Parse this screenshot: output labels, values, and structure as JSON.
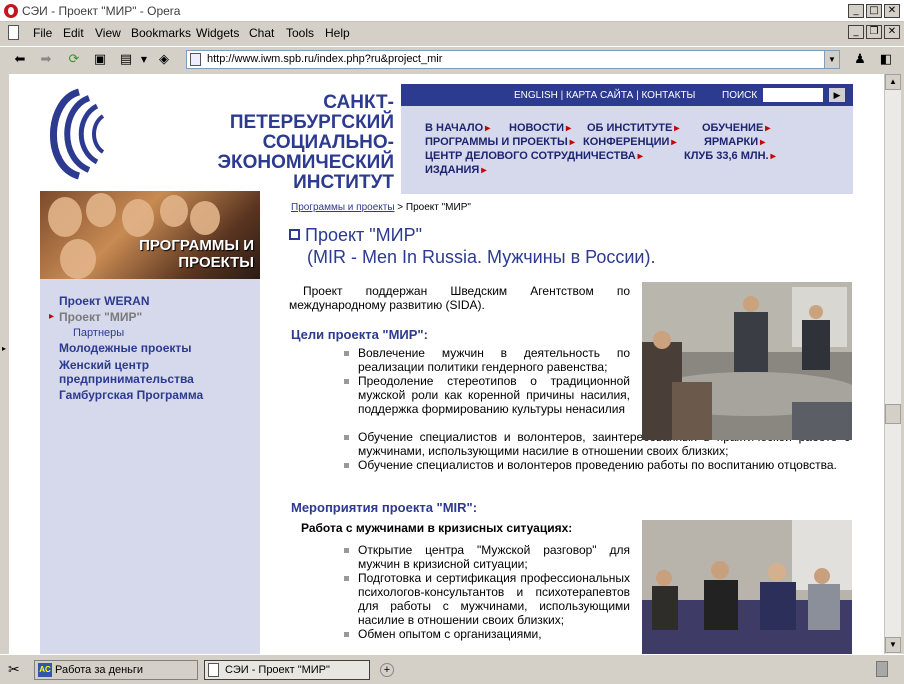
{
  "window": {
    "title": "СЭИ - Проект \"МИР\" - Opera"
  },
  "menu": [
    "File",
    "Edit",
    "View",
    "Bookmarks",
    "Widgets",
    "Chat",
    "Tools",
    "Help"
  ],
  "address": {
    "url": "http://www.iwm.spb.ru/index.php?ru&project_mir"
  },
  "site": {
    "logo_text": [
      "САНКТ-ПЕТЕРБУРГСКИЙ",
      "СОЦИАЛЬНО-",
      "ЭКОНОМИЧЕСКИЙ",
      "ИНСТИТУТ"
    ],
    "top_links": "ENGLISH | КАРТА САЙТА | КОНТАКТЫ",
    "search_label": "ПОИСК",
    "nav": [
      "В НАЧАЛО",
      "НОВОСТИ",
      "ОБ ИНСТИТУТЕ",
      "ОБУЧЕНИЕ",
      "ПРОГРАММЫ И ПРОЕКТЫ",
      "КОНФЕРЕНЦИИ",
      "ЯРМАРКИ",
      "ЦЕНТР ДЕЛОВОГО СОТРУДНИЧЕСТВА",
      "КЛУБ 33,6 МЛН.",
      "ИЗДАНИЯ"
    ]
  },
  "left": {
    "banner_text": "ПРОГРАММЫ И ПРОЕКТЫ",
    "items": [
      "Проект WERAN",
      "Проект \"МИР\"",
      "Партнеры",
      "Молодежные проекты",
      "Женский центр",
      "предпринимательства",
      "Гамбургская Программа"
    ]
  },
  "content": {
    "crumb_link": "Программы и проекты",
    "crumb_current": " > Проект \"МИР\"",
    "title_line1": "Проект \"МИР\"",
    "title_line2": "(MIR - Men In Russia. Мужчины в России).",
    "intro": "Проект поддержан Шведским Агентством по международному развитию (SIDA).",
    "goals_heading": "Цели проекта \"МИР\":",
    "goals": [
      "Вовлечение мужчин в деятельность по реализации политики гендерного равенства;",
      "Преодоление стереотипов о традиционной мужской роли как коренной причины насилия, поддержка формированию культуры ненасилия",
      "Обучение специалистов и волонтеров, заинтересованных в практической работе с мужчинами, использующими насилие в отношении своих близких;",
      "Обучение специалистов и волонтеров проведению работы по воспитанию отцовства."
    ],
    "events_heading": "Мероприятия проекта \"MIR\":",
    "crisis_heading": "Работа с мужчинами в кризисных ситуациях:",
    "events": [
      "Открытие центра \"Мужской разговор\" для мужчин в кризисной ситуации;",
      "Подготовка и сертификация профессиональных психологов-консультантов и психотерапевтов для работы с мужчинами, использующими насилие в отношении своих близких;",
      "Обмен опытом с организациями,"
    ]
  },
  "taskbar": {
    "task1": "Работа за деньги",
    "task2": "СЭИ - Проект \"МИР\""
  }
}
